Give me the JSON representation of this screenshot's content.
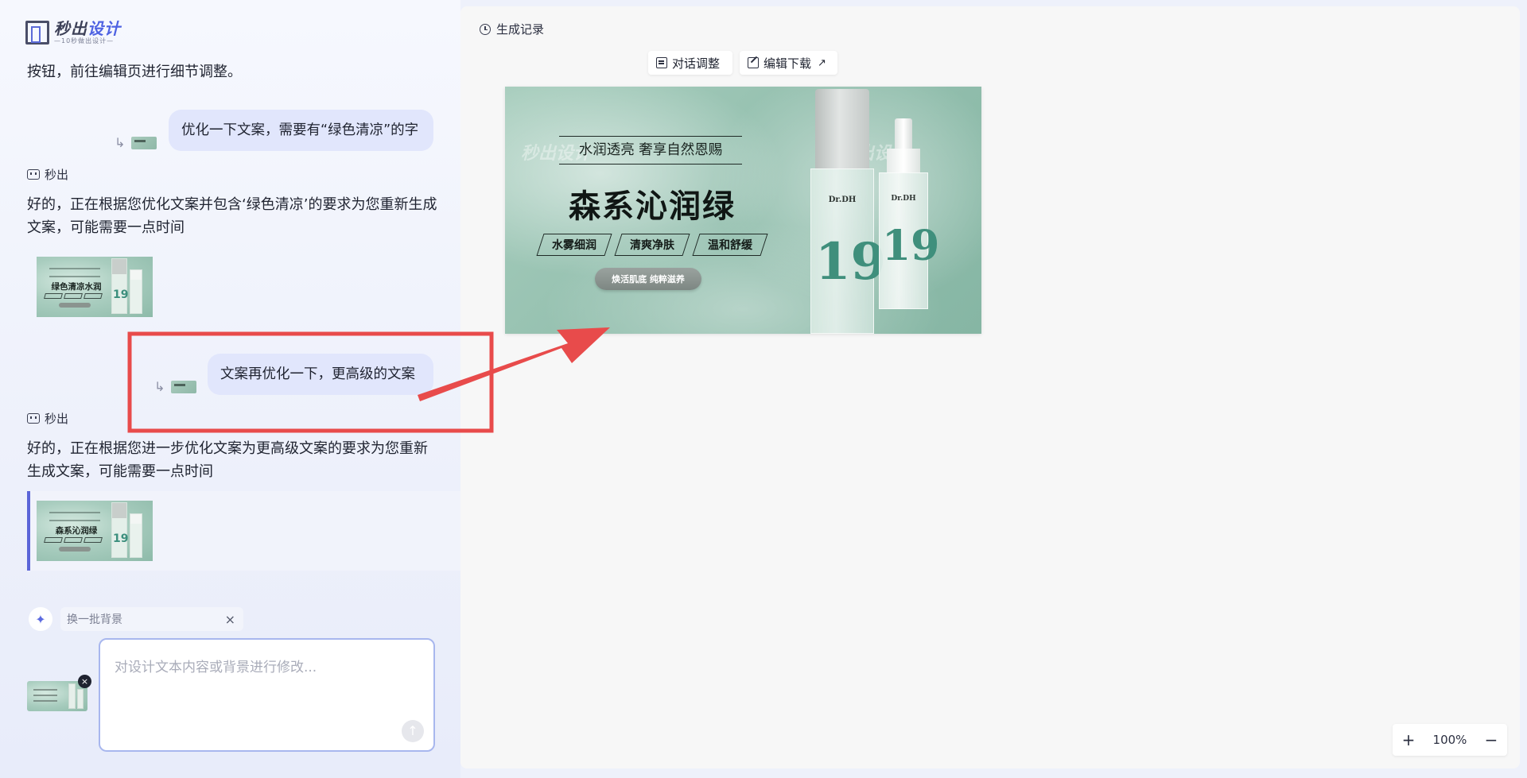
{
  "logo": {
    "name_part1": "秒出",
    "name_part2": "设计",
    "tagline": "—10秒做出设计—"
  },
  "chat": {
    "top_fragment": "按钮，前往编辑页进行细节调整。",
    "user_message_1": "优化一下文案，需要有“绿色清凉”的字",
    "sender_name": "秒出",
    "ai_message_1": "好的，正在根据您优化文案并包含‘绿色清凉’的要求为您重新生成文案，可能需要一点时间",
    "user_message_2": "文案再优化一下，更高级的文案",
    "ai_message_2": "好的，正在根据您进一步优化文案为更高级文案的要求为您重新生成文案，可能需要一点时间",
    "thumb_1_title": "绿色清凉水润",
    "thumb_2_title": "森系沁润绿"
  },
  "composer": {
    "hint_chip": "换一批背景",
    "placeholder": "对设计文本内容或背景进行修改..."
  },
  "canvas": {
    "history_label": "生成记录",
    "dialog_adjust_label": "对话调整",
    "edit_download_label": "编辑下载",
    "zoom_level": "100%",
    "zoom_in": "+",
    "zoom_out": "−"
  },
  "design": {
    "subtitle": "水润透亮 奢享自然恩赐",
    "title": "森系沁润绿",
    "tags": [
      "水雾细润",
      "清爽净肤",
      "温和舒缓"
    ],
    "pill": "焕活肌底 纯粹滋养",
    "brand": "Dr.DH",
    "product_number": "19",
    "watermark": "秒出设计"
  },
  "colors": {
    "accent": "#5b65d8",
    "bubble": "#e1e6fc",
    "annotation_red": "#e84b4b",
    "design_green": "#93bfae"
  }
}
